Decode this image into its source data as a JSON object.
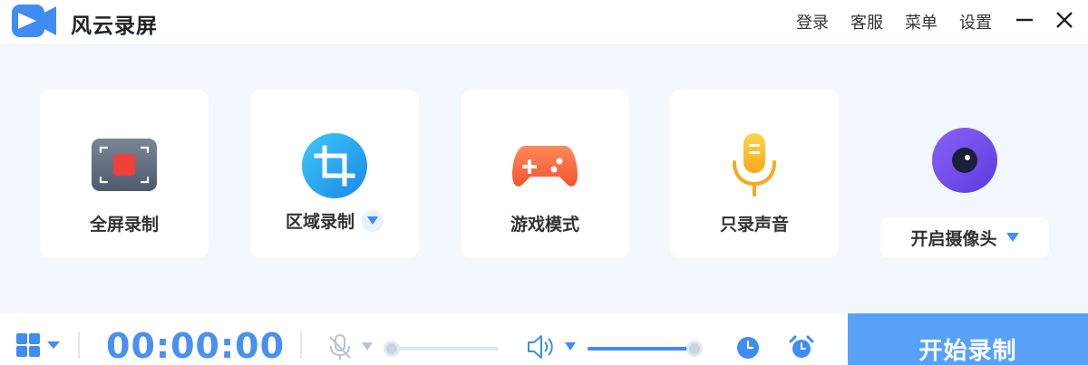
{
  "app": {
    "title": "风云录屏",
    "brand_color": "#3f8cf5"
  },
  "titlebar": {
    "menu": [
      {
        "label": "登录",
        "name": "login"
      },
      {
        "label": "客服",
        "name": "customer-service"
      },
      {
        "label": "菜单",
        "name": "menu"
      },
      {
        "label": "设置",
        "name": "settings"
      }
    ],
    "minimize_icon": "minimize-icon",
    "close_icon": "close-icon"
  },
  "modes": [
    {
      "label": "全屏录制",
      "icon": "fullscreen-record-icon",
      "has_dropdown": false
    },
    {
      "label": "区域录制",
      "icon": "crop-region-icon",
      "has_dropdown": true
    },
    {
      "label": "游戏模式",
      "icon": "gamepad-icon",
      "has_dropdown": false
    },
    {
      "label": "只录声音",
      "icon": "microphone-icon",
      "has_dropdown": false
    }
  ],
  "camera": {
    "label": "开启摄像头",
    "icon": "webcam-icon",
    "has_dropdown": true
  },
  "bottom": {
    "layout_icon": "grid-layout-icon",
    "timer": "00:00:00",
    "mic": {
      "icon": "microphone-muted-icon",
      "level": 0.0
    },
    "speaker": {
      "icon": "speaker-icon",
      "level": 1.0
    },
    "schedule_icon": "clock-icon",
    "alarm_icon": "alarm-clock-icon",
    "record_label": "开始录制"
  },
  "colors": {
    "accent": "#57a2f8",
    "timer": "#4a90f0",
    "background": "#f3f8fe"
  }
}
